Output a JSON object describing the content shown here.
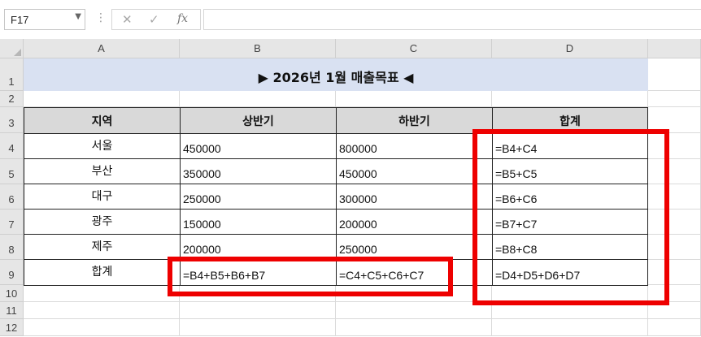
{
  "formula_bar": {
    "name_box": "F17",
    "cancel_icon": "✕",
    "enter_icon": "✓",
    "fx_label": "fx",
    "formula": ""
  },
  "columns": [
    "A",
    "B",
    "C",
    "D"
  ],
  "rows": [
    "1",
    "2",
    "3",
    "4",
    "5",
    "6",
    "7",
    "8",
    "9",
    "10",
    "11",
    "12"
  ],
  "sheet": {
    "title": "▶ 2026년 1월 매출목표 ◀",
    "headers": [
      "지역",
      "상반기",
      "하반기",
      "합계"
    ],
    "data": [
      {
        "region": "서울",
        "h1": "450000",
        "h2": "800000",
        "total": "=B4+C4"
      },
      {
        "region": "부산",
        "h1": "350000",
        "h2": "450000",
        "total": "=B5+C5"
      },
      {
        "region": "대구",
        "h1": "250000",
        "h2": "300000",
        "total": "=B6+C6"
      },
      {
        "region": "광주",
        "h1": "150000",
        "h2": "200000",
        "total": "=B7+C7"
      },
      {
        "region": "제주",
        "h1": "200000",
        "h2": "250000",
        "total": "=B8+C8"
      }
    ],
    "sum_row": {
      "label": "합계",
      "h1": "=B4+B5+B6+B7",
      "h2": "=C4+C5+C6+C7",
      "total": "=D4+D5+D6+D7"
    }
  },
  "colors": {
    "highlight": "#ee0000",
    "title_fill": "#d9e1f2",
    "header_fill": "#d9d9d9"
  }
}
